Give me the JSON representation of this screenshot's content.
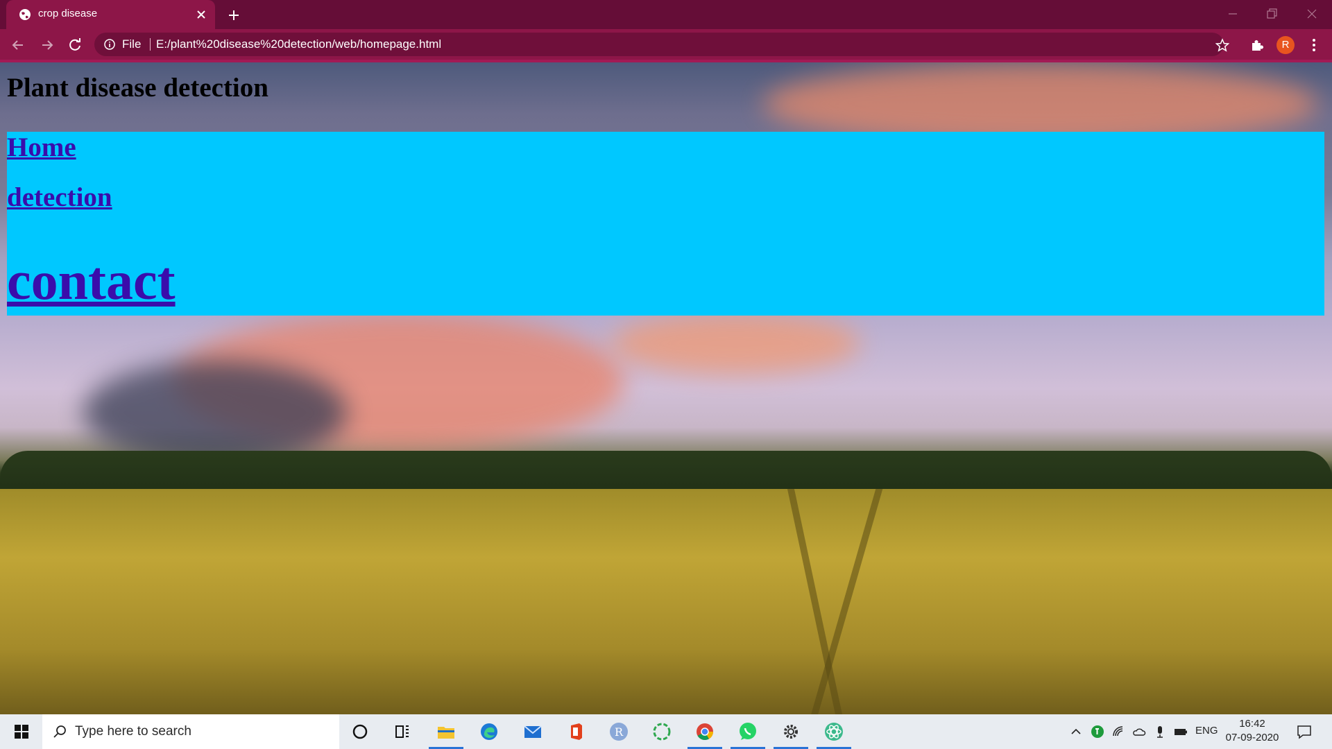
{
  "browser": {
    "tab_title": "crop disease",
    "omnibox_scheme_label": "File",
    "omnibox_url": "E:/plant%20disease%20detection/web/homepage.html",
    "profile_initial": "R",
    "accent_color": "#8d1648"
  },
  "page": {
    "title": "Plant disease detection",
    "nav_background": "#00c8ff",
    "nav": [
      {
        "label": "Home"
      },
      {
        "label": "detection"
      },
      {
        "label": "contact"
      }
    ]
  },
  "taskbar": {
    "search_placeholder": "Type here to search",
    "language": "ENG",
    "time": "16:42",
    "date": "07-09-2020",
    "pinned_apps": [
      "cortana-icon",
      "task-view-icon",
      "file-explorer-icon",
      "edge-icon",
      "mail-icon",
      "office-icon",
      "r-app-icon",
      "refresh-app-icon",
      "chrome-icon",
      "whatsapp-icon",
      "settings-icon",
      "atom-icon"
    ]
  }
}
